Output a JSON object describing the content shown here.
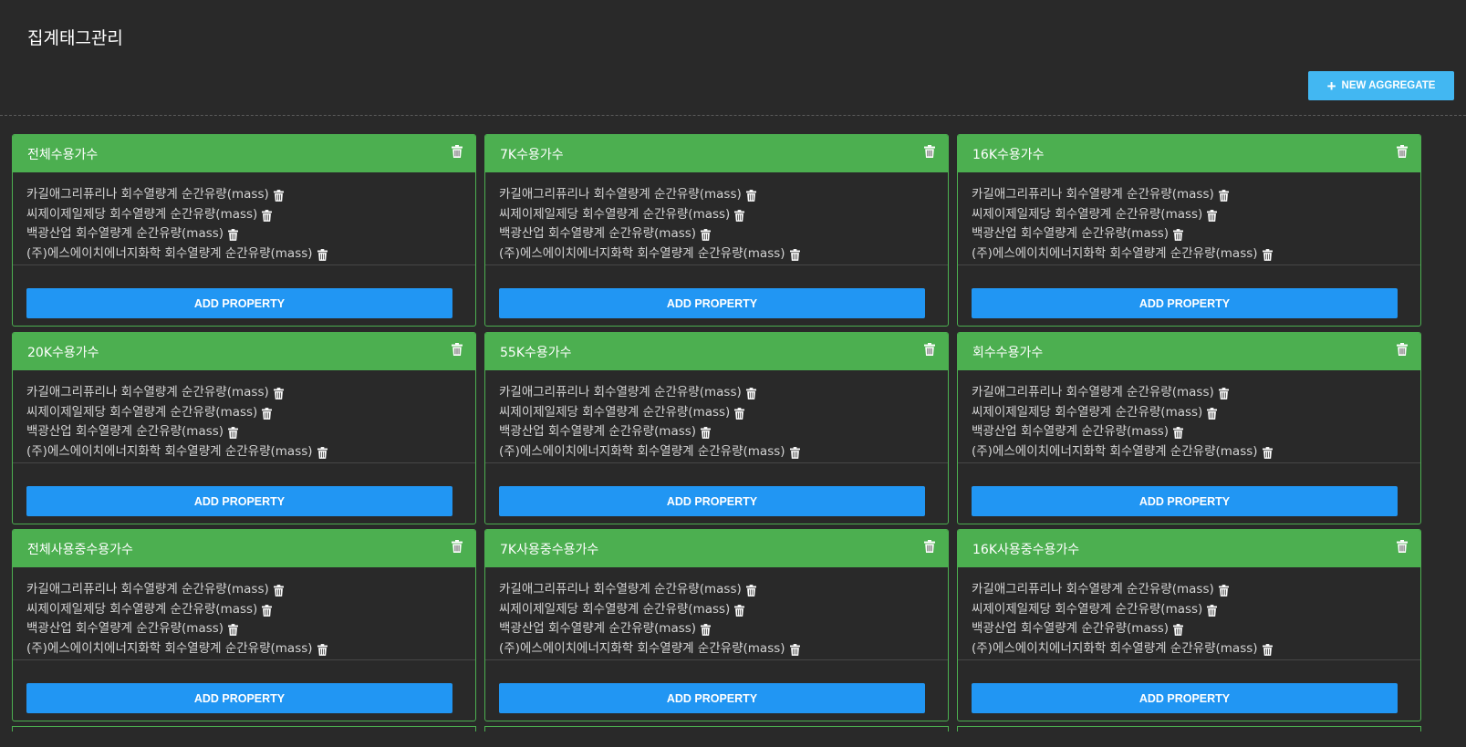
{
  "page": {
    "title": "집계태그관리",
    "new_button_label": "NEW AGGREGATE",
    "add_property_label": "ADD PROPERTY"
  },
  "colors": {
    "background": "#292929",
    "card_header": "#4caf50",
    "primary_button": "#2196f3",
    "new_button": "#42b7f2"
  },
  "icons": {
    "new": "plus-icon",
    "delete": "trash-icon"
  },
  "aggregates": [
    {
      "title": "전체수용가수",
      "properties": [
        "카길애그리퓨리나 회수열량계 순간유량(mass)",
        "씨제이제일제당 회수열량계 순간유량(mass)",
        "백광산업 회수열량계 순간유량(mass)",
        "(주)에스에이치에너지화학 회수열량계 순간유량(mass)"
      ]
    },
    {
      "title": "7K수용가수",
      "properties": [
        "카길애그리퓨리나 회수열량계 순간유량(mass)",
        "씨제이제일제당 회수열량계 순간유량(mass)",
        "백광산업 회수열량계 순간유량(mass)",
        "(주)에스에이치에너지화학 회수열량계 순간유량(mass)"
      ]
    },
    {
      "title": "16K수용가수",
      "properties": [
        "카길애그리퓨리나 회수열량계 순간유량(mass)",
        "씨제이제일제당 회수열량계 순간유량(mass)",
        "백광산업 회수열량계 순간유량(mass)",
        "(주)에스에이치에너지화학 회수열량계 순간유량(mass)"
      ]
    },
    {
      "title": "20K수용가수",
      "properties": [
        "카길애그리퓨리나 회수열량계 순간유량(mass)",
        "씨제이제일제당 회수열량계 순간유량(mass)",
        "백광산업 회수열량계 순간유량(mass)",
        "(주)에스에이치에너지화학 회수열량계 순간유량(mass)"
      ]
    },
    {
      "title": "55K수용가수",
      "properties": [
        "카길애그리퓨리나 회수열량계 순간유량(mass)",
        "씨제이제일제당 회수열량계 순간유량(mass)",
        "백광산업 회수열량계 순간유량(mass)",
        "(주)에스에이치에너지화학 회수열량계 순간유량(mass)"
      ]
    },
    {
      "title": "회수수용가수",
      "properties": [
        "카길애그리퓨리나 회수열량계 순간유량(mass)",
        "씨제이제일제당 회수열량계 순간유량(mass)",
        "백광산업 회수열량계 순간유량(mass)",
        "(주)에스에이치에너지화학 회수열량계 순간유량(mass)"
      ]
    },
    {
      "title": "전체사용중수용가수",
      "properties": [
        "카길애그리퓨리나 회수열량계 순간유량(mass)",
        "씨제이제일제당 회수열량계 순간유량(mass)",
        "백광산업 회수열량계 순간유량(mass)",
        "(주)에스에이치에너지화학 회수열량계 순간유량(mass)"
      ]
    },
    {
      "title": "7K사용중수용가수",
      "properties": [
        "카길애그리퓨리나 회수열량계 순간유량(mass)",
        "씨제이제일제당 회수열량계 순간유량(mass)",
        "백광산업 회수열량계 순간유량(mass)",
        "(주)에스에이치에너지화학 회수열량계 순간유량(mass)"
      ]
    },
    {
      "title": "16K사용중수용가수",
      "properties": [
        "카길애그리퓨리나 회수열량계 순간유량(mass)",
        "씨제이제일제당 회수열량계 순간유량(mass)",
        "백광산업 회수열량계 순간유량(mass)",
        "(주)에스에이치에너지화학 회수열량계 순간유량(mass)"
      ]
    }
  ]
}
